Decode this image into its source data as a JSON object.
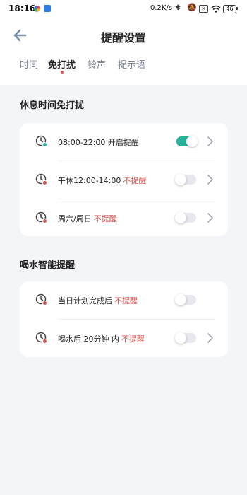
{
  "status_bar": {
    "time": "18:16",
    "net_speed": "0.2K/s",
    "battery": "46"
  },
  "header": {
    "title": "提醒设置"
  },
  "tabs": [
    {
      "label": "时间",
      "active": false
    },
    {
      "label": "免打扰",
      "active": true
    },
    {
      "label": "铃声",
      "active": false
    },
    {
      "label": "提示语",
      "active": false
    }
  ],
  "section_rest": {
    "title": "休息时间免打扰",
    "rows": [
      {
        "text": "08:00-22:00 开启提醒",
        "status": "",
        "enabled": true
      },
      {
        "text": "午休12:00-14:00",
        "status": "不提醒",
        "enabled": false
      },
      {
        "text": "周六/周日",
        "status": "不提醒",
        "enabled": false
      }
    ]
  },
  "section_water": {
    "title": "喝水智能提醒",
    "rows": [
      {
        "text": "当日计划完成后",
        "status": "不提醒",
        "enabled": false
      },
      {
        "text": "喝水后 20分钟 内",
        "status": "不提醒",
        "enabled": false
      }
    ]
  },
  "colors": {
    "accent": "#27b39b",
    "warning_text": "#d9534f",
    "background": "#f4f5f9"
  }
}
